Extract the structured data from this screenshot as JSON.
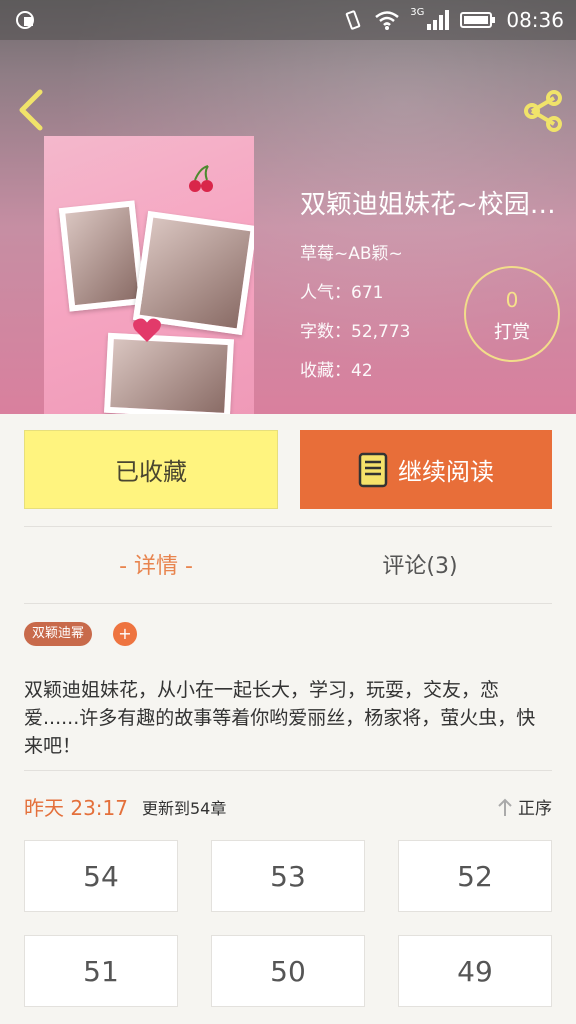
{
  "status_bar": {
    "time": "08:36",
    "network": "3G"
  },
  "colors": {
    "accent": "#e86e39",
    "collected_bg": "#fff47f",
    "tab_active": "#e8844e",
    "tag_bg": "#c86a4b"
  },
  "icons": {
    "back": "chevron-left-icon",
    "share": "share-icon",
    "read": "book-icon",
    "sort": "arrow-up-icon"
  },
  "book": {
    "title": "双颖迪姐妹花~校园…",
    "author": "草莓~AB颖~",
    "popularity": "人气：671",
    "word_count": "字数：52,773",
    "favorites": "收藏：42"
  },
  "tip": {
    "count": "0",
    "label": "打赏"
  },
  "actions": {
    "collected": "已收藏",
    "continue_reading": "继续阅读"
  },
  "tabs": {
    "detail": "- 详情 -",
    "comments": "评论(3)"
  },
  "tag": {
    "label": "双颖迪幂",
    "add": "+"
  },
  "description": "双颖迪姐妹花，从小在一起长大，学习，玩耍，交友，恋爱......许多有趣的故事等着你哟爱丽丝，杨家将，萤火虫，快来吧！",
  "update": {
    "time": "昨天 23:17",
    "text": "更新到54章",
    "sort_label": "正序"
  },
  "chapters": [
    "54",
    "53",
    "52",
    "51",
    "50",
    "49"
  ]
}
